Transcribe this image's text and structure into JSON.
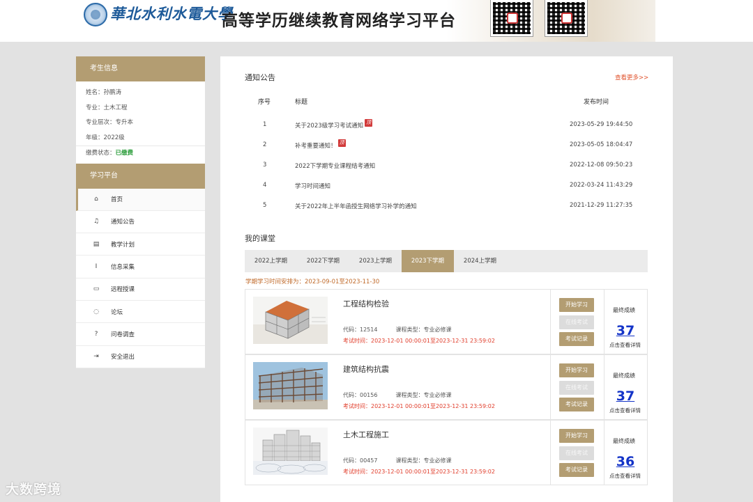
{
  "header": {
    "school_name": "華北水利水電大學",
    "platform_title": "高等学历继续教育网络学习平台"
  },
  "sidebar": {
    "student_info_title": "考生信息",
    "info": [
      {
        "label": "姓名：",
        "value": "孙鹏涛"
      },
      {
        "label": "专业：",
        "value": "土木工程"
      },
      {
        "label": "专业层次：",
        "value": "专升本"
      },
      {
        "label": "年级：",
        "value": "2022级"
      }
    ],
    "payment": {
      "label": "缴费状态：",
      "value": "已缴费"
    },
    "platform_title": "学习平台",
    "nav": [
      {
        "label": "首页",
        "icon": "home-icon",
        "glyph": "⌂"
      },
      {
        "label": "通知公告",
        "icon": "bell-icon",
        "glyph": "♫"
      },
      {
        "label": "教学计划",
        "icon": "book-icon",
        "glyph": "▤"
      },
      {
        "label": "信息采集",
        "icon": "italic-icon",
        "glyph": "I"
      },
      {
        "label": "远程授课",
        "icon": "monitor-icon",
        "glyph": "▭"
      },
      {
        "label": "论坛",
        "icon": "comment-icon",
        "glyph": "◌"
      },
      {
        "label": "问卷调查",
        "icon": "question-icon",
        "glyph": "?"
      },
      {
        "label": "安全退出",
        "icon": "logout-icon",
        "glyph": "⇥"
      }
    ]
  },
  "notices": {
    "title": "通知公告",
    "more": "查看更多>>",
    "headers": {
      "index": "序号",
      "title": "标题",
      "date": "发布时间"
    },
    "top_badge": "顶",
    "rows": [
      {
        "index": "1",
        "title": "关于2023级学习考试通知",
        "date": "2023-05-29 19:44:50",
        "top": true
      },
      {
        "index": "2",
        "title": "补考重要通知！",
        "date": "2023-05-05 18:04:47",
        "top": true
      },
      {
        "index": "3",
        "title": "2022下学期专业课程结考通知",
        "date": "2022-12-08 09:50:23",
        "top": false
      },
      {
        "index": "4",
        "title": "学习时间通知",
        "date": "2022-03-24 11:43:29",
        "top": false
      },
      {
        "index": "5",
        "title": "关于2022年上半年函授生网络学习补学的通知",
        "date": "2021-12-29 11:27:35",
        "top": false
      }
    ]
  },
  "classroom": {
    "title": "我的课堂",
    "tabs": [
      "2022上学期",
      "2022下学期",
      "2023上学期",
      "2023下学期",
      "2024上学期"
    ],
    "active_tab": 3,
    "term_note": "学期学习时间安排为：2023-09-01至2023-11-30",
    "buttons": {
      "start": "开始学习",
      "exam": "在线考试",
      "record": "考试记录"
    },
    "score_label": "最终成绩",
    "score_hint": "点击查看详情",
    "courses": [
      {
        "name": "工程结构检验",
        "code": "代码：12514",
        "type": "课程类型：专业必修课",
        "exam_time": "考试时间：2023-12-01 00:00:01至2023-12-31 23:59:02",
        "score": "37"
      },
      {
        "name": "建筑结构抗震",
        "code": "代码：00156",
        "type": "课程类型：专业必修课",
        "exam_time": "考试时间：2023-12-01 00:00:01至2023-12-31 23:59:02",
        "score": "37"
      },
      {
        "name": "土木工程施工",
        "code": "代码：00457",
        "type": "课程类型：专业必修课",
        "exam_time": "考试时间：2023-12-01 00:00:01至2023-12-31 23:59:02",
        "score": "36"
      }
    ]
  },
  "watermark": "大数跨境",
  "colors": {
    "accent": "#b39d72",
    "link": "#e0532d",
    "score": "#1434c8",
    "exam_time": "#e03c2a"
  }
}
